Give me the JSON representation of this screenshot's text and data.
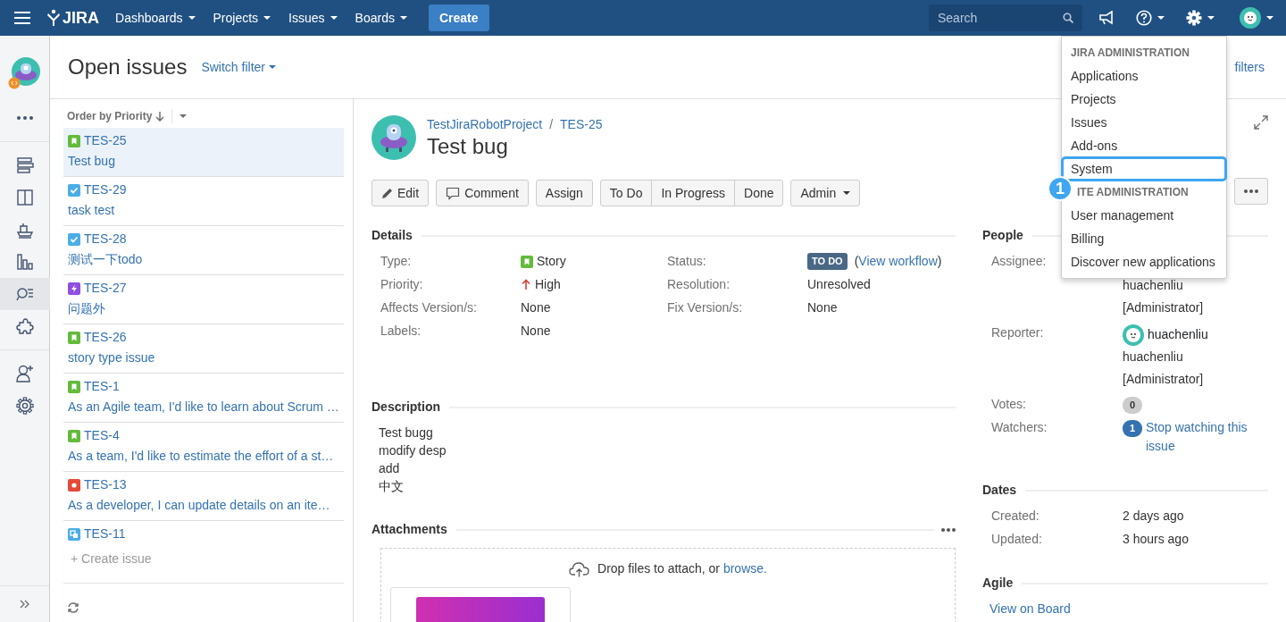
{
  "navbar": {
    "menus": [
      {
        "label": "Dashboards"
      },
      {
        "label": "Projects"
      },
      {
        "label": "Issues"
      },
      {
        "label": "Boards"
      }
    ],
    "logo": "JIRA",
    "create": "Create",
    "search": {
      "placeholder": "Search"
    },
    "settings_open": true
  },
  "sidebar": {
    "items": [
      {
        "kind": "backlog",
        "selected": false
      },
      {
        "kind": "board",
        "selected": false
      },
      {
        "kind": "releases",
        "selected": false
      },
      {
        "kind": "reports",
        "selected": false
      },
      {
        "kind": "issues",
        "selected": true
      },
      {
        "kind": "addons",
        "selected": false
      }
    ]
  },
  "header": {
    "title": "Open issues",
    "switch_filter": "Switch filter",
    "filters_link": "filters"
  },
  "issue_list": {
    "order": "Order by Priority",
    "issues": [
      {
        "key": "TES-25",
        "summary": "Test bug",
        "kind": "story",
        "selected": true
      },
      {
        "key": "TES-29",
        "summary": "task test",
        "kind": "task",
        "selected": false
      },
      {
        "key": "TES-28",
        "summary": "测试一下todo",
        "kind": "task",
        "selected": false
      },
      {
        "key": "TES-27",
        "summary": "问题外",
        "kind": "epic",
        "selected": false
      },
      {
        "key": "TES-26",
        "summary": "story type issue",
        "kind": "story",
        "selected": false
      },
      {
        "key": "TES-1",
        "summary": "As an Agile team, I'd like to learn about Scrum …",
        "kind": "story",
        "selected": false
      },
      {
        "key": "TES-4",
        "summary": "As a team, I'd like to estimate the effort of a st…",
        "kind": "story",
        "selected": false
      },
      {
        "key": "TES-13",
        "summary": "As a developer, I can update details on an ite…",
        "kind": "bug",
        "selected": false
      },
      {
        "key": "TES-11",
        "kind": "subtask",
        "selected": false
      }
    ],
    "create": "+ Create issue"
  },
  "issue": {
    "project": "TestJiraRobotProject",
    "separator": "/",
    "key": "TES-25",
    "title": "Test bug",
    "actions": [
      {
        "label": "Edit",
        "kind": "edit"
      },
      {
        "label": "Comment",
        "kind": "comment"
      },
      {
        "label": "Assign",
        "kind": "plain"
      }
    ],
    "workflow": [
      "To Do",
      "In Progress",
      "Done"
    ],
    "admin": "Admin",
    "details": {
      "heading": "Details",
      "left": [
        {
          "label": "Type:",
          "value": "Story",
          "kind": "type"
        },
        {
          "label": "Priority:",
          "value": "High",
          "kind": "priority"
        },
        {
          "label": "Affects Version/s:",
          "value": "None",
          "kind": "text"
        },
        {
          "label": "Labels:",
          "value": "None",
          "kind": "text"
        }
      ],
      "right": [
        {
          "label": "Status:",
          "value": "TO DO",
          "kind": "status",
          "link_before": "(",
          "link": "View workflow",
          "link_after": ")"
        },
        {
          "label": "Resolution:",
          "value": "Unresolved",
          "kind": "text"
        },
        {
          "label": "Fix Version/s:",
          "value": "None",
          "kind": "text"
        }
      ]
    },
    "description": {
      "heading": "Description",
      "lines": [
        "Test bugg",
        "modify desp",
        "add",
        "中文"
      ]
    },
    "attachments": {
      "heading": "Attachments",
      "drop_text": "Drop files to attach, or",
      "browse": "browse."
    }
  },
  "people": {
    "heading": "People",
    "fields": [
      {
        "label": "Assignee:",
        "kind": "person",
        "lines": [
          "huachenliu",
          "[Administrator]"
        ]
      },
      {
        "label": "Reporter:",
        "kind": "person",
        "avatar_name": "huachenliu",
        "lines": [
          "huachenliu",
          "[Administrator]"
        ]
      },
      {
        "label": "Votes:",
        "kind": "votes",
        "count": "0"
      },
      {
        "label": "Watchers:",
        "kind": "watchers",
        "count": "1",
        "link": "Stop watching this issue"
      }
    ]
  },
  "dates": {
    "heading": "Dates",
    "fields": [
      {
        "label": "Created:",
        "value": "2 days ago"
      },
      {
        "label": "Updated:",
        "value": "3 hours ago"
      }
    ]
  },
  "agile": {
    "heading": "Agile",
    "link": "View on Board"
  },
  "admin_menu": {
    "sections": [
      {
        "heading": "JIRA ADMINISTRATION",
        "items": [
          {
            "label": "Applications",
            "selected": false
          },
          {
            "label": "Projects",
            "selected": false
          },
          {
            "label": "Issues",
            "selected": false
          },
          {
            "label": "Add-ons",
            "selected": false
          },
          {
            "label": "System",
            "selected": true
          }
        ]
      },
      {
        "heading": "ITE ADMINISTRATION",
        "items": [
          {
            "label": "User management",
            "selected": false
          },
          {
            "label": "Billing",
            "selected": false
          },
          {
            "label": "Discover new applications",
            "selected": false
          }
        ]
      }
    ],
    "callout": "1"
  }
}
